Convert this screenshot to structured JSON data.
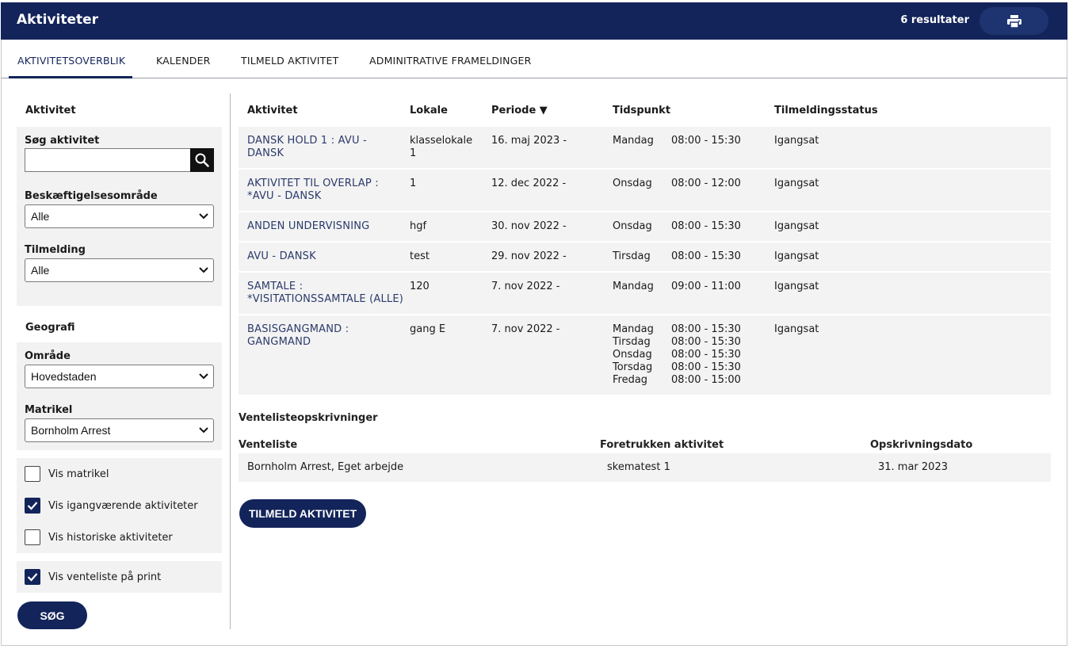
{
  "header": {
    "title": "Aktiviteter",
    "result_count": "6 resultater",
    "print_icon": "printer-icon"
  },
  "tabs": [
    {
      "label": "AKTIVITETSOVERBLIK",
      "active": true
    },
    {
      "label": "KALENDER"
    },
    {
      "label": "TILMELD AKTIVITET"
    },
    {
      "label": "ADMINITRATIVE FRAMELDINGER"
    }
  ],
  "sidebar": {
    "activity_title": "Aktivitet",
    "search_label": "Søg aktivitet",
    "search_value": "",
    "area_label": "Beskæftigelsesområde",
    "area_value": "Alle",
    "signup_label": "Tilmelding",
    "signup_value": "Alle",
    "geo_title": "Geografi",
    "region_label": "Område",
    "region_value": "Hovedstaden",
    "matrikel_label": "Matrikel",
    "matrikel_value": "Bornholm Arrest",
    "checkboxes": [
      {
        "label": "Vis matrikel",
        "checked": false
      },
      {
        "label": "Vis igangværende aktiviteter",
        "checked": true
      },
      {
        "label": "Vis historiske aktiviteter",
        "checked": false
      }
    ],
    "print_checkbox": {
      "label": "Vis venteliste på print",
      "checked": true
    },
    "search_button": "SØG"
  },
  "table": {
    "headers": {
      "aktivitet": "Aktivitet",
      "lokale": "Lokale",
      "periode": "Periode ▼",
      "tidspunkt": "Tidspunkt",
      "status": "Tilmeldingsstatus"
    },
    "rows": [
      {
        "aktivitet": [
          "DANSK HOLD 1 : AVU -",
          "DANSK"
        ],
        "lokale": [
          "klasselokale",
          "1"
        ],
        "periode": "16. maj 2023 -",
        "days": [
          "Mandag"
        ],
        "times": [
          "08:00 - 15:30"
        ],
        "status": "Igangsat"
      },
      {
        "aktivitet": [
          "AKTIVITET TIL OVERLAP :",
          "*AVU - DANSK"
        ],
        "lokale": [
          "1"
        ],
        "periode": "12. dec 2022 -",
        "days": [
          "Onsdag"
        ],
        "times": [
          "08:00 - 12:00"
        ],
        "status": "Igangsat"
      },
      {
        "aktivitet": [
          "ANDEN UNDERVISNING"
        ],
        "lokale": [
          "hgf"
        ],
        "periode": "30. nov 2022 -",
        "days": [
          "Onsdag"
        ],
        "times": [
          "08:00 - 15:30"
        ],
        "status": "Igangsat"
      },
      {
        "aktivitet": [
          "AVU - DANSK"
        ],
        "lokale": [
          "test"
        ],
        "periode": "29. nov 2022 -",
        "days": [
          "Tirsdag"
        ],
        "times": [
          "08:00 - 15:30"
        ],
        "status": "Igangsat"
      },
      {
        "aktivitet": [
          "SAMTALE :",
          "*VISITATIONSSAMTALE (ALLE)"
        ],
        "lokale": [
          "120"
        ],
        "periode": "7. nov 2022 -",
        "days": [
          "Mandag"
        ],
        "times": [
          "09:00 - 11:00"
        ],
        "status": "Igangsat"
      },
      {
        "aktivitet": [
          "BASISGANGMAND :",
          "GANGMAND"
        ],
        "lokale": [
          "gang E"
        ],
        "periode": "7. nov 2022 -",
        "days": [
          "Mandag",
          "Tirsdag",
          "Onsdag",
          "Torsdag",
          "Fredag"
        ],
        "times": [
          "08:00 - 15:30",
          "08:00 - 15:30",
          "08:00 - 15:30",
          "08:00 - 15:30",
          "08:00 - 15:00"
        ],
        "status": "Igangsat"
      }
    ]
  },
  "waitlist": {
    "title": "Ventelisteopskrivninger",
    "headers": {
      "venteliste": "Venteliste",
      "foretrukken": "Foretrukken aktivitet",
      "dato": "Opskrivningsdato"
    },
    "rows": [
      {
        "venteliste": "Bornholm Arrest, Eget arbejde",
        "foretrukken": "skematest 1",
        "dato": "31. mar 2023"
      }
    ]
  },
  "enroll_button": "TILMELD AKTIVITET",
  "colors": {
    "navy": "#13245a",
    "row_bg": "#f3f3f3",
    "panel_bg": "#f2f2f2"
  }
}
